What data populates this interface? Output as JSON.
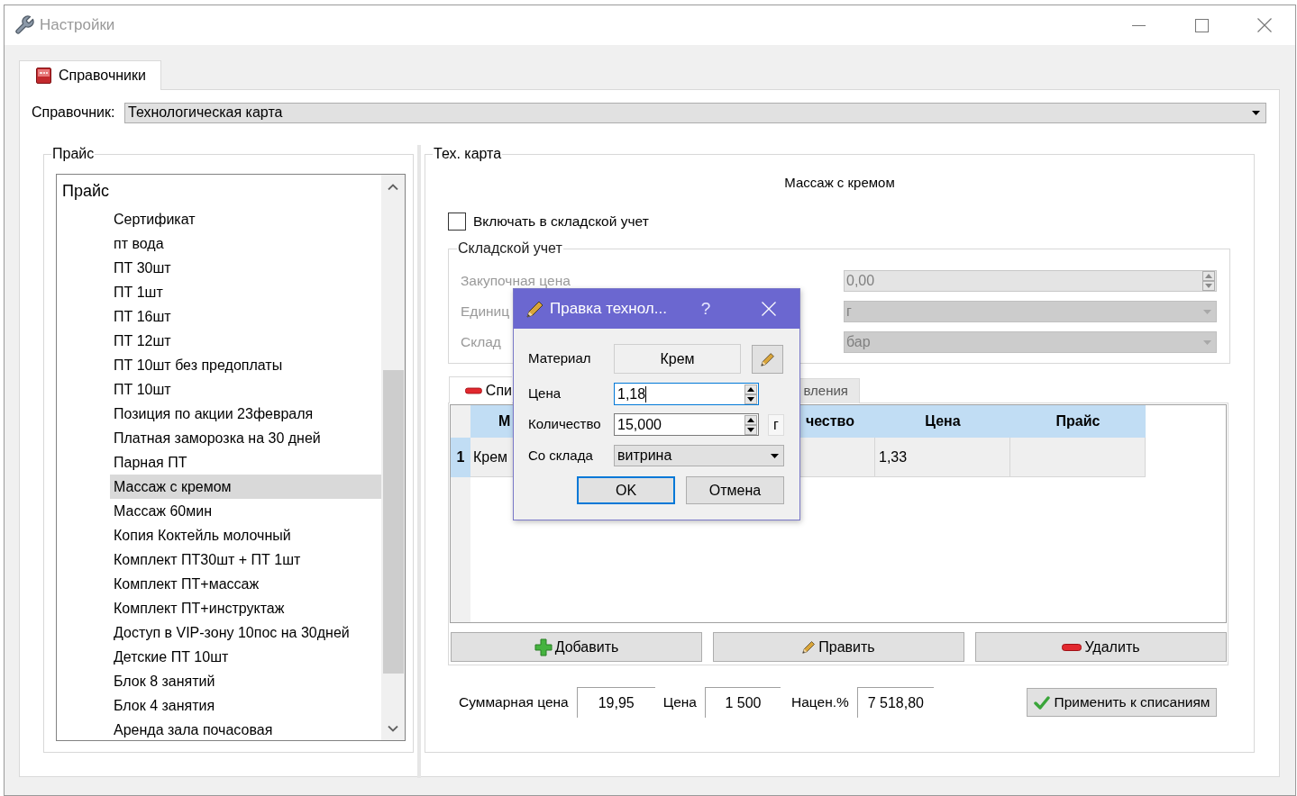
{
  "window": {
    "title": "Настройки"
  },
  "tabs": [
    {
      "label": "Справочники",
      "selected": true
    }
  ],
  "directory": {
    "label": "Справочник:",
    "value": "Технологическая карта"
  },
  "price_group": {
    "title": "Прайс",
    "tree": [
      {
        "label": "Прайс",
        "selected": false,
        "children": [
          {
            "label": "Сертификат",
            "selected": false
          },
          {
            "label": "пт вода",
            "selected": false
          },
          {
            "label": "ПТ 30шт",
            "selected": false
          },
          {
            "label": "ПТ 1шт",
            "selected": false
          },
          {
            "label": "ПТ 16шт",
            "selected": false
          },
          {
            "label": "ПТ 12шт",
            "selected": false
          },
          {
            "label": "ПТ 10шт без предоплаты",
            "selected": false
          },
          {
            "label": "ПТ 10шт",
            "selected": false
          },
          {
            "label": "Позиция по акции 23февраля",
            "selected": false
          },
          {
            "label": "Платная заморозка на 30 дней",
            "selected": false
          },
          {
            "label": "Парная ПТ",
            "selected": false
          },
          {
            "label": "Массаж с кремом",
            "selected": true
          },
          {
            "label": "Массаж 60мин",
            "selected": false
          },
          {
            "label": "Копия Коктейль молочный",
            "selected": false
          },
          {
            "label": "Комплект ПТ30шт + ПТ 1шт",
            "selected": false
          },
          {
            "label": "Комплект ПТ+массаж",
            "selected": false
          },
          {
            "label": "Комплект ПТ+инструктаж",
            "selected": false
          },
          {
            "label": "Доступ в VIP-зону 10пос на 30дней",
            "selected": false
          },
          {
            "label": "Детские ПТ 10шт",
            "selected": false
          },
          {
            "label": "Блок 8 занятий",
            "selected": false
          },
          {
            "label": "Блок 4 занятия",
            "selected": false
          },
          {
            "label": "Аренда зала почасовая",
            "selected": false
          }
        ]
      }
    ]
  },
  "tech_card": {
    "title": "Тех. карта",
    "heading": "Массаж с кремом",
    "include_in_stock": {
      "label": "Включать в складской учет",
      "checked": false
    },
    "stock_group": {
      "title": "Складской учет",
      "disabled": true,
      "fields": [
        {
          "kind": "spinbox",
          "label": "Закупочная цена",
          "value": "0,00"
        },
        {
          "kind": "combo",
          "label": "Единиц",
          "value": "г"
        },
        {
          "kind": "combo",
          "label": "Склад",
          "value": "бар"
        }
      ]
    },
    "tabs": [
      {
        "label": "Спи",
        "selected": true
      },
      {
        "label": "вления",
        "selected": false
      }
    ],
    "table": {
      "columns": [
        "М",
        "чество",
        "Цена",
        "Прайс"
      ],
      "rows": [
        {
          "number": "1",
          "cells": {
            "column_1": "Крем",
            "column_3": "1,33"
          }
        }
      ]
    },
    "buttons": [
      {
        "kind": "add",
        "label": "Добавить"
      },
      {
        "kind": "edit",
        "label": "Править"
      },
      {
        "kind": "delete",
        "label": "Удалить"
      }
    ],
    "totals": [
      {
        "label": "Суммарная цена",
        "value": "19,95"
      },
      {
        "label": "Цена",
        "value": "1 500"
      },
      {
        "label": "Нацен.%",
        "value": "7 518,80"
      }
    ],
    "apply_button": {
      "label": "Применить к списаниям"
    }
  },
  "dialog": {
    "title": "Правка технол...",
    "help": "?",
    "material": {
      "label": "Материал",
      "value": "Крем"
    },
    "price": {
      "label": "Цена",
      "value": "1,18",
      "focused": true
    },
    "quantity": {
      "label": "Количество",
      "value": "15,000",
      "unit": "г",
      "focused": false
    },
    "source": {
      "label": "Со склада",
      "value": "витрина"
    },
    "buttons": [
      {
        "label": "OK",
        "default": true
      },
      {
        "label": "Отмена",
        "default": false
      }
    ]
  }
}
